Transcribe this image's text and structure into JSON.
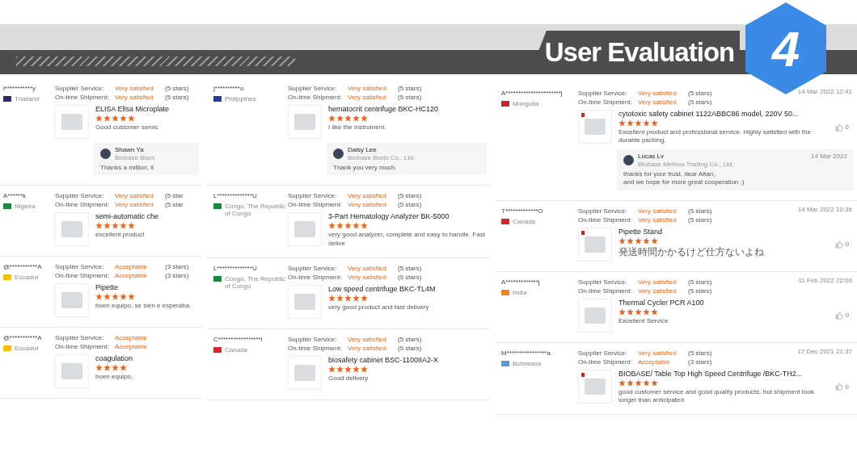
{
  "banner": {
    "title": "User Evaluation",
    "number": "4"
  },
  "columns": [
    {
      "kind": "narrow",
      "reviews": [
        {
          "user": "l***********y",
          "country": "Thailand",
          "color": "#2d2a6e",
          "service_label": "Supplier Service:",
          "service": "Very satisfied",
          "service_note": "(5 stars)",
          "shipment_label": "On-time Shipment:",
          "shipment": "Very satisfied",
          "shipment_note": "(5 stars)",
          "product": "ELISA Elisa Microplate",
          "stars": 5,
          "comment": "Good customer servic",
          "reply": {
            "name": "Shawn Ya",
            "company": "Biobase Biom",
            "text": "Thanks a million, it"
          }
        },
        {
          "user": "A******k",
          "country": "Nigeria",
          "color": "#1a8a3c",
          "service_label": "Supplier Service:",
          "service": "Very satisfied",
          "service_note": "(5 star",
          "shipment_label": "On-time Shipment:",
          "shipment": "Very satisfied",
          "shipment_note": "(5 star",
          "product": "semi-automatic che",
          "stars": 5,
          "comment": "excellent product"
        },
        {
          "user": "@***********A",
          "country": "Ecuador",
          "color": "#f2c200",
          "service_label": "Supplier Service:",
          "service": "Acceptable",
          "service_note": "(3 stars)",
          "shipment_label": "On-time Shipment:",
          "shipment": "Acceptable",
          "shipment_note": "(3 stars)",
          "product": "Pipette",
          "stars": 5,
          "comment": "buen equipo, se sien e esperaba."
        },
        {
          "user": "@***********A",
          "country": "Ecuador",
          "color": "#f2c200",
          "service_label": "Supplier Service:",
          "service": "Acceptable",
          "shipment_label": "On-time Shipment:",
          "shipment": "Acceptable",
          "product": "coagulation",
          "stars": 4,
          "comment": "buen equipo,"
        }
      ]
    },
    {
      "kind": "medium",
      "reviews": [
        {
          "user": "j**********o",
          "country": "Philippines",
          "color": "#1d3f9e",
          "service_label": "Supplier Service:",
          "service": "Very satisfied",
          "service_note": "(5 stars)",
          "shipment_label": "On-time Shipment:",
          "shipment": "Very satisfied",
          "shipment_note": "(5 stars)",
          "product": "hematocrit centrifuge BKC-HC120",
          "stars": 5,
          "comment": "I like the instrument.",
          "reply": {
            "name": "Daisy Lee",
            "company": "Biobase Biolin Co., Ltd.",
            "text": "Thank you very much."
          }
        },
        {
          "user": "L**************U",
          "country": "Congo, The Republic of Congo",
          "color": "#1a8a3c",
          "service_label": "Supplier Service:",
          "service": "Very satisfied",
          "service_note": "(5 stars)",
          "shipment_label": "On-time Shipment:",
          "shipment": "Very satisfied",
          "shipment_note": "(5 stars)",
          "product": "3-Part Hematology Analyzer BK-5000",
          "stars": 5,
          "comment": "very good analyzer, complete and easy to handle. Fast delive"
        },
        {
          "user": "L**************U",
          "country": "Congo, The Republic of Congo",
          "color": "#1a8a3c",
          "service_label": "Supplier Service:",
          "service": "Very satisfied",
          "service_note": "(5 stars)",
          "shipment_label": "On-time Shipment:",
          "shipment": "Very satisfied",
          "shipment_note": "(5 stars)",
          "product": "Low speed centrifuge BKC-TL4M",
          "stars": 5,
          "comment": "very good product and fast delivery"
        },
        {
          "user": "C*****************l",
          "country": "Canada",
          "color": "#d62828",
          "service_label": "Supplier Service:",
          "service": "Very satisfied",
          "service_note": "(5 stars)",
          "shipment_label": "On-time Shipment:",
          "shipment": "Very satisfied",
          "shipment_note": "(5 stars)",
          "product": "biosafety cabinet BSC-1100IIA2-X",
          "stars": 5,
          "comment": "Good delivery"
        }
      ]
    },
    {
      "kind": "wide",
      "reviews": [
        {
          "user": "A**********************j",
          "country": "Mongolia",
          "color": "#c4272f",
          "date": "14 Mar 2022 12:41",
          "service_label": "Supplier Service:",
          "service": "Very satisfied",
          "service_note": "(5 stars)",
          "shipment_label": "On-time Shipment:",
          "shipment": "Very satisfied",
          "shipment_note": "(5 stars)",
          "product": "cytotoxic safety cabinet 1122ABBC86 model, 220V 50...",
          "stars": 5,
          "comment": "Excellent product and professional service. Highly satisfied with the durable packing.",
          "likes": "0",
          "reply": {
            "name": "Lucas Lv",
            "company": "Biobase Meihua Trading Co., Ltd.",
            "date": "14 Mar 2022",
            "text": "thanks for your trust, dear Altan,\nand we hope for more great cooperation :)"
          }
        },
        {
          "user": "T*************O",
          "country": "Canada",
          "color": "#d62828",
          "date": "14 Mar 2022 10:36",
          "service_label": "Supplier Service:",
          "service": "Very satisfied",
          "service_note": "(5 stars)",
          "shipment_label": "On-time Shipment:",
          "shipment": "Very satisfied",
          "shipment_note": "(5 stars)",
          "product": "Pipette Stand",
          "stars": 5,
          "comment": "発送時間かかるけど仕方ないよね",
          "likes": "0"
        },
        {
          "user": "A*************j",
          "country": "India",
          "color": "#f58220",
          "date": "11 Feb 2022 22:00",
          "service_label": "Supplier Service:",
          "service": "Very satisfied",
          "service_note": "(5 stars)",
          "shipment_label": "On-time Shipment:",
          "shipment": "Very satisfied",
          "shipment_note": "(5 stars)",
          "product": "Thermal Cycler PCR A100",
          "stars": 5,
          "comment": "Excellent Service",
          "likes": "0"
        },
        {
          "user": "M****************a",
          "country": "Botswana",
          "color": "#5b9bd5",
          "date": "17 Dec 2021 21:37",
          "service_label": "Supplier Service:",
          "service": "Very satisfied",
          "service_note": "(5 stars)",
          "shipment_label": "On-time Shipment:",
          "shipment": "Acceptable",
          "shipment_note": "(3 stars)",
          "product": "BIOBASE/ Table Top High Speed Centrifuge /BKC-TH2...",
          "stars": 5,
          "comment": "good customer service and good quality products, but shipment took longer than anticipated",
          "likes": "0"
        }
      ]
    }
  ]
}
